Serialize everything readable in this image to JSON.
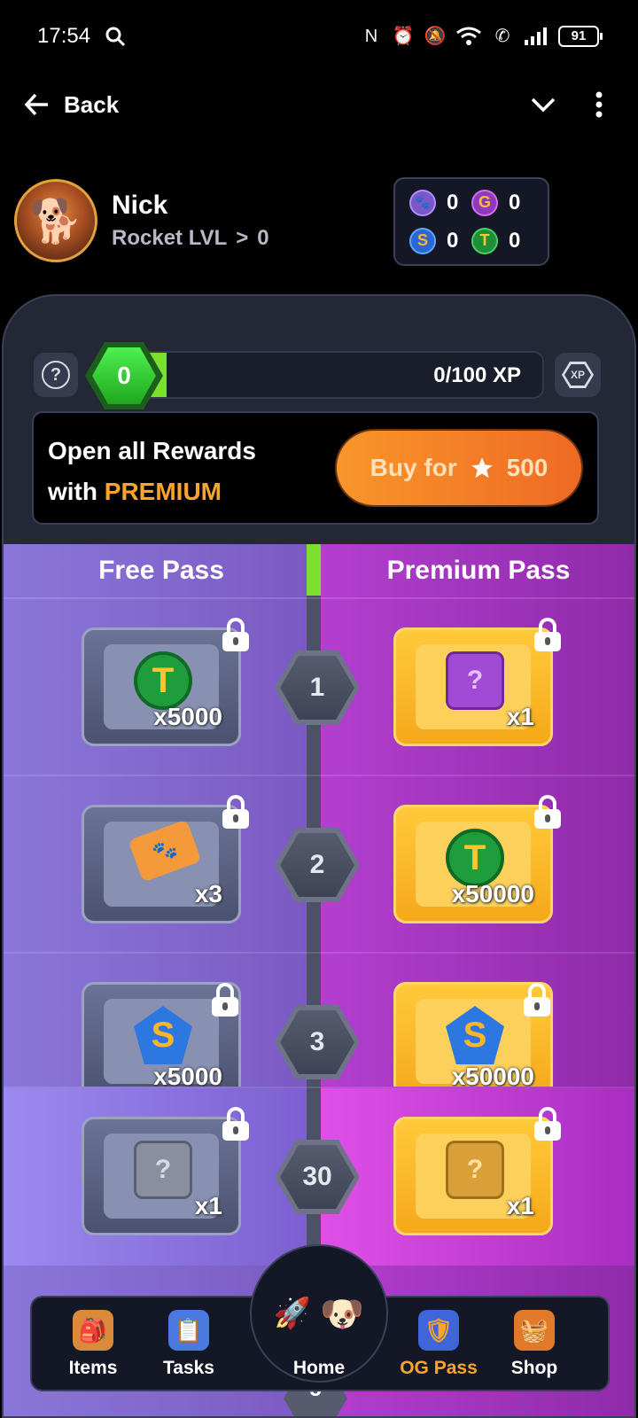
{
  "status_bar": {
    "time": "17:54",
    "battery": "91"
  },
  "nav": {
    "back_label": "Back"
  },
  "profile": {
    "name": "Nick",
    "rank_label": "Rocket LVL",
    "rank_sep": ">",
    "rank_value": "0"
  },
  "currencies": [
    {
      "icon": "paw-coin-icon",
      "letter": "🐾",
      "value": "0"
    },
    {
      "icon": "g-coin-icon",
      "letter": "G",
      "value": "0"
    },
    {
      "icon": "s-coin-icon",
      "letter": "S",
      "value": "0"
    },
    {
      "icon": "t-coin-icon",
      "letter": "T",
      "value": "0"
    }
  ],
  "xp": {
    "level": "0",
    "text": "0/100 XP",
    "progress": 0.0,
    "badge": "XP"
  },
  "premium": {
    "line1": "Open all Rewards",
    "line2_prefix": "with ",
    "line2_highlight": "PREMIUM",
    "buy_label": "Buy for",
    "price": "500"
  },
  "passes": {
    "free_header": "Free Pass",
    "premium_header": "Premium Pass",
    "rows": [
      {
        "level": "1",
        "free_qty": "x5000",
        "premium_qty": "x1"
      },
      {
        "level": "2",
        "free_qty": "x3",
        "premium_qty": "x50000"
      },
      {
        "level": "3",
        "free_qty": "x5000",
        "premium_qty": "x50000"
      },
      {
        "level": "30",
        "free_qty": "x1",
        "premium_qty": "x1"
      }
    ],
    "peek_level": "5"
  },
  "bottom_nav": {
    "items": "Items",
    "tasks": "Tasks",
    "home": "Home",
    "og_pass": "OG Pass",
    "shop": "Shop"
  },
  "colors": {
    "accent": "#ffa42b",
    "xp_green": "#7be02b",
    "free_col": "#8a77d8",
    "premium_col": "#b33fd0"
  }
}
